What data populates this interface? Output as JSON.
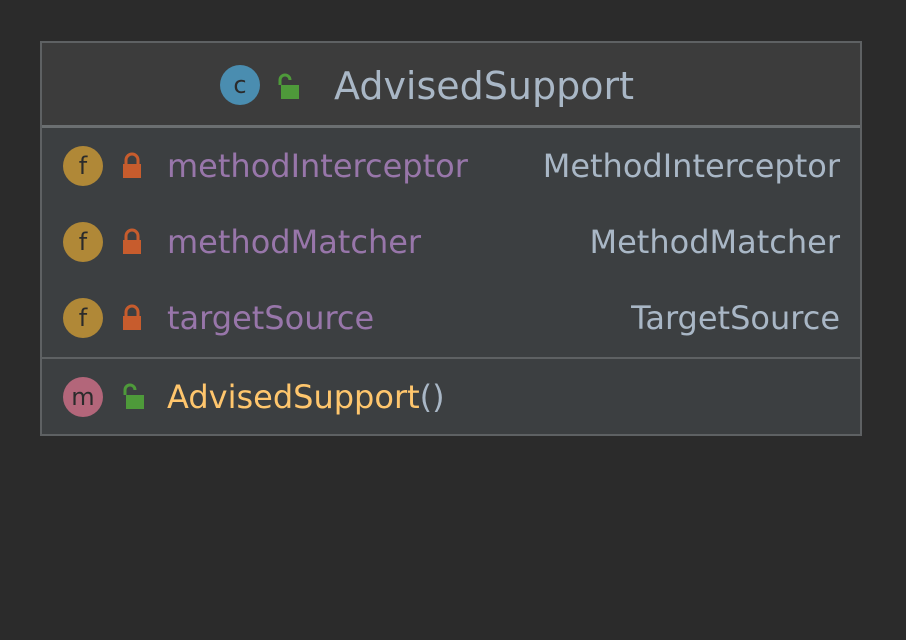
{
  "class": {
    "name": "AdvisedSupport",
    "kind_letter": "c",
    "icon": "class-icon",
    "visibility_icon": "unlocked-public-icon"
  },
  "fields": [
    {
      "name": "methodInterceptor",
      "type": "MethodInterceptor",
      "kind_letter": "f",
      "visibility_icon": "locked-private-icon"
    },
    {
      "name": "methodMatcher",
      "type": "MethodMatcher",
      "kind_letter": "f",
      "visibility_icon": "locked-private-icon"
    },
    {
      "name": "targetSource",
      "type": "TargetSource",
      "kind_letter": "f",
      "visibility_icon": "locked-private-icon"
    }
  ],
  "methods": [
    {
      "name": "AdvisedSupport",
      "params": "()",
      "kind_letter": "m",
      "visibility_icon": "unlocked-public-icon"
    }
  ],
  "colors": {
    "background": "#2b2b2b",
    "box": "#3c3f41",
    "class_badge": "#4a8db0",
    "field_badge": "#b08837",
    "method_badge": "#b3667a",
    "field_name": "#9876aa",
    "method_name": "#ffc66d",
    "type_text": "#a9b7c6",
    "private_lock": "#c75c2d",
    "public_lock": "#4e9a3a"
  }
}
